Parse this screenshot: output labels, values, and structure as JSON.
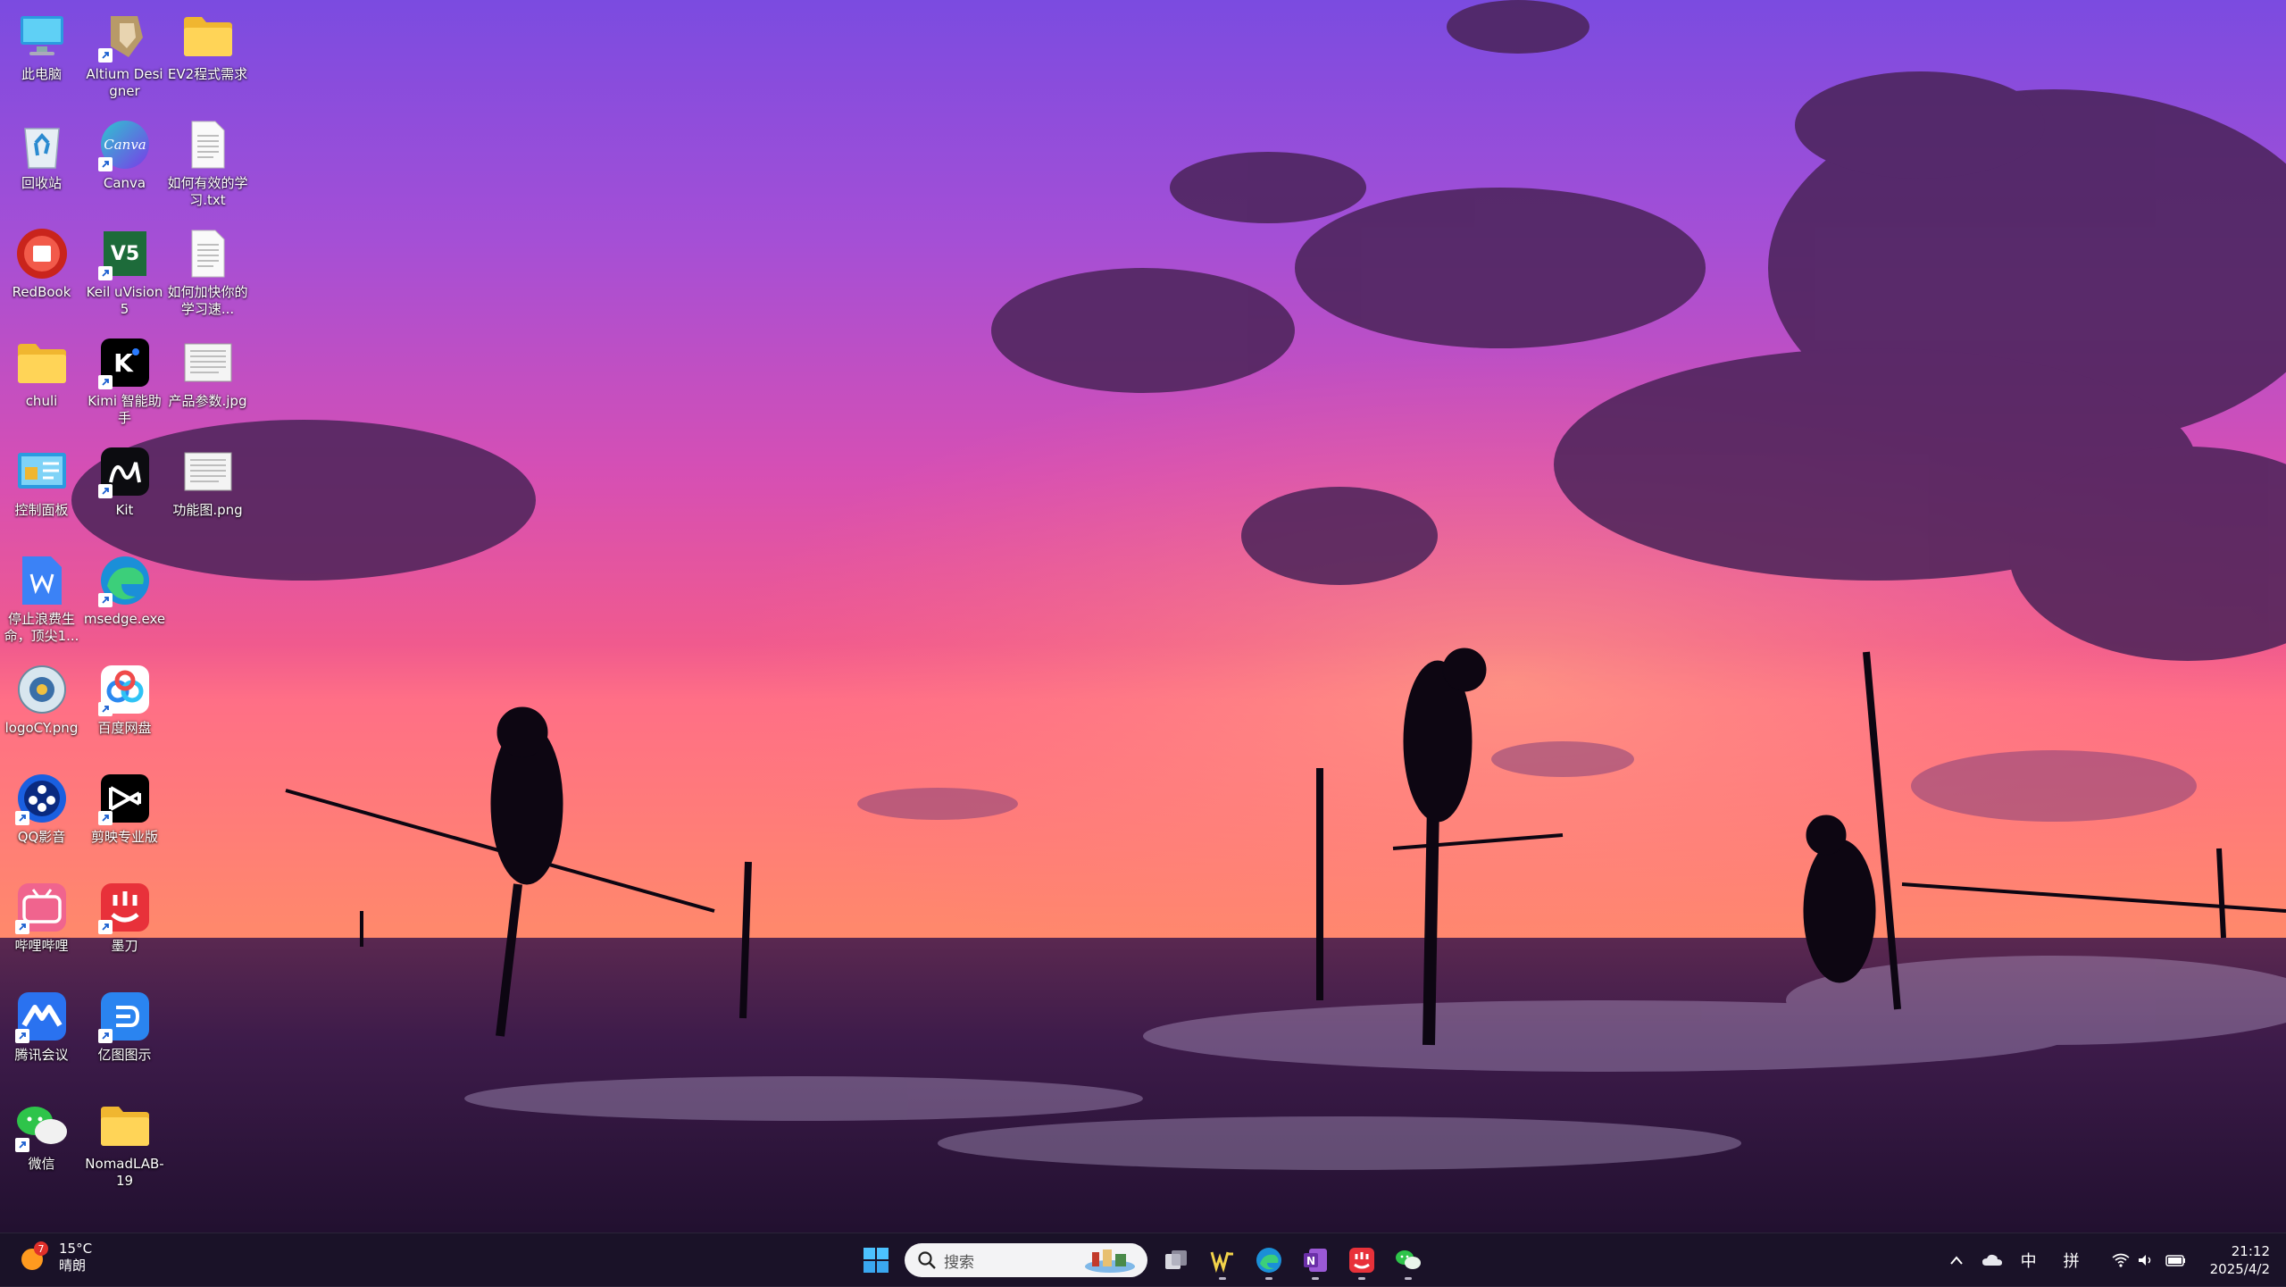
{
  "colors": {
    "sky_top": "#8a4fd8",
    "sky_mid": "#d44fb8",
    "horizon": "#ff5e8a",
    "sea": "#2a1438",
    "taskbar": "#1a1228"
  },
  "desktop": {
    "icons": [
      {
        "label": "此电脑",
        "icon": "computer-icon",
        "shortcut": false
      },
      {
        "label": "Altium Designer",
        "icon": "altium-icon",
        "shortcut": true
      },
      {
        "label": "EV2程式需求",
        "icon": "folder-icon",
        "shortcut": false
      },
      {
        "label": "回收站",
        "icon": "recycle-bin-icon",
        "shortcut": false
      },
      {
        "label": "Canva",
        "icon": "canva-icon",
        "shortcut": true
      },
      {
        "label": "如何有效的学习.txt",
        "icon": "text-file-icon",
        "shortcut": false
      },
      {
        "label": "RedBook",
        "icon": "redbook-icon",
        "shortcut": false
      },
      {
        "label": "Keil uVision5",
        "icon": "keil-icon",
        "shortcut": true
      },
      {
        "label": "如何加快你的学习速...",
        "icon": "text-file-icon",
        "shortcut": false
      },
      {
        "label": "chuli",
        "icon": "folder-icon",
        "shortcut": false
      },
      {
        "label": "Kimi 智能助手",
        "icon": "kimi-icon",
        "shortcut": true
      },
      {
        "label": "产品参数.jpg",
        "icon": "image-file-icon",
        "shortcut": false
      },
      {
        "label": "控制面板",
        "icon": "control-panel-icon",
        "shortcut": false
      },
      {
        "label": "Kit",
        "icon": "kit-icon",
        "shortcut": true
      },
      {
        "label": "功能图.png",
        "icon": "image-file-icon",
        "shortcut": false
      },
      {
        "label": "停止浪费生命，顶尖1...",
        "icon": "word-doc-icon",
        "shortcut": false
      },
      {
        "label": "msedge.exe",
        "icon": "edge-icon",
        "shortcut": true
      },
      {
        "label": "",
        "icon": "",
        "shortcut": false
      },
      {
        "label": "logoCY.png",
        "icon": "png-file-icon",
        "shortcut": false
      },
      {
        "label": "百度网盘",
        "icon": "baidu-netdisk-icon",
        "shortcut": true
      },
      {
        "label": "",
        "icon": "",
        "shortcut": false
      },
      {
        "label": "QQ影音",
        "icon": "qq-player-icon",
        "shortcut": true
      },
      {
        "label": "剪映专业版",
        "icon": "capcut-icon",
        "shortcut": true
      },
      {
        "label": "",
        "icon": "",
        "shortcut": false
      },
      {
        "label": "哔哩哔哩",
        "icon": "bilibili-icon",
        "shortcut": true
      },
      {
        "label": "墨刀",
        "icon": "modao-icon",
        "shortcut": true
      },
      {
        "label": "",
        "icon": "",
        "shortcut": false
      },
      {
        "label": "腾讯会议",
        "icon": "tencent-meeting-icon",
        "shortcut": true
      },
      {
        "label": "亿图图示",
        "icon": "edraw-icon",
        "shortcut": true
      },
      {
        "label": "",
        "icon": "",
        "shortcut": false
      },
      {
        "label": "微信",
        "icon": "wechat-icon",
        "shortcut": true
      },
      {
        "label": "NomadLAB-19",
        "icon": "folder-icon",
        "shortcut": false
      }
    ]
  },
  "taskbar": {
    "weather": {
      "temp": "15°C",
      "condition": "晴朗",
      "badge": "7"
    },
    "search_placeholder": "搜索",
    "apps": [
      "start-icon",
      "task-view-icon",
      "wps-icon",
      "edge-icon",
      "onenote-icon",
      "modao-icon",
      "wechat-icon"
    ],
    "tray": {
      "input_method_1": "中",
      "input_method_2": "拼"
    },
    "clock": {
      "time": "21:12",
      "date": "2025/4/2"
    }
  }
}
